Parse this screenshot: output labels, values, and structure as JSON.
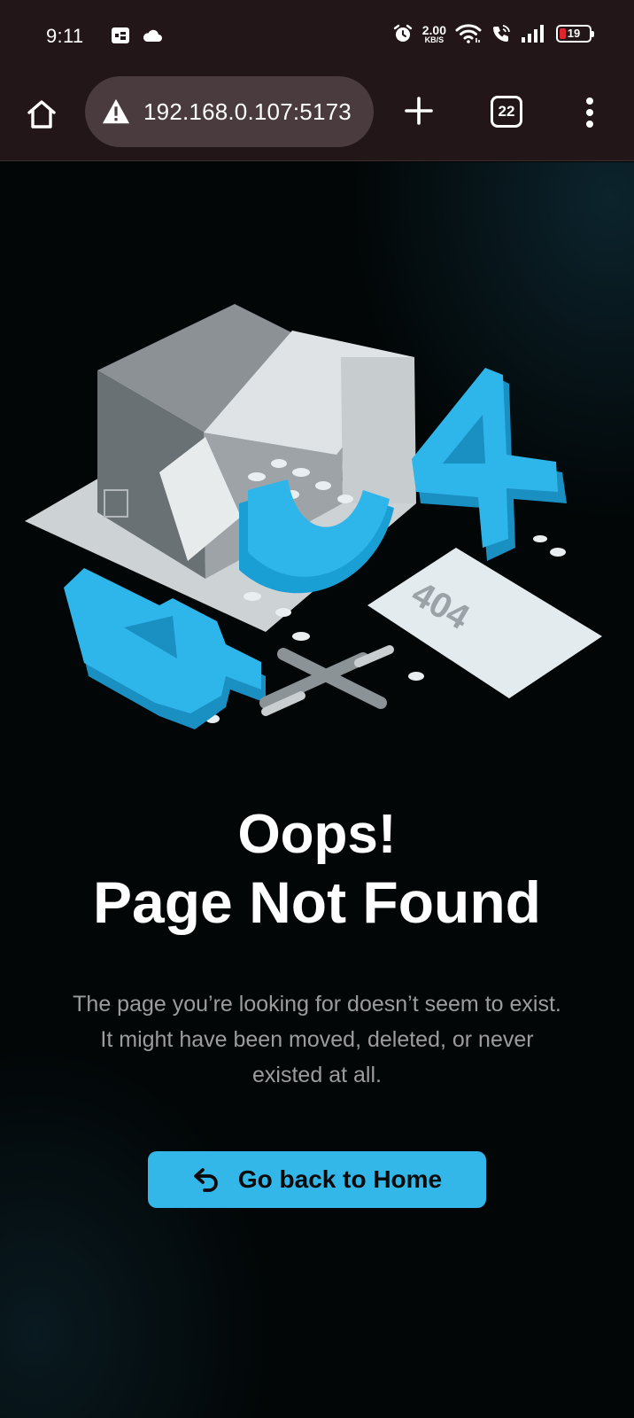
{
  "status_bar": {
    "time": "9:11",
    "net_speed_value": "2.00",
    "net_speed_unit": "KB/S",
    "battery_level": "19",
    "icons": [
      "gallery-icon",
      "cloud-icon",
      "alarm-icon",
      "wifi-icon",
      "wifi-calling-icon",
      "signal-icon",
      "battery-icon"
    ]
  },
  "browser": {
    "url": "192.168.0.107:5173",
    "tab_count": "22",
    "icons": [
      "home-icon",
      "warning-icon",
      "new-tab-icon",
      "tabs-icon",
      "more-menu-icon"
    ]
  },
  "main": {
    "illustration": {
      "icon": "404-box-illustration",
      "digits": [
        "4",
        "0",
        "4"
      ],
      "paper_text": "404"
    },
    "title_line1": "Oops!",
    "title_line2": "Page Not Found",
    "subtitle_line1": "The page you’re looking for doesn’t seem to exist.",
    "subtitle_line2": "It might have been moved, deleted, or never",
    "subtitle_line3": "existed at all.",
    "home_button_label": "Go back to Home",
    "home_button_icon": "undo-arrow-icon",
    "accent_color": "#33b6e8"
  }
}
